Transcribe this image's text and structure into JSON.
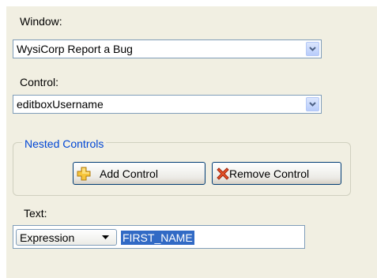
{
  "window_label": "Window:",
  "window_value": "WysiCorp  Report a Bug",
  "control_label": "Control:",
  "control_value": "editboxUsername",
  "nested": {
    "title": "Nested Controls",
    "add_button": "Add Control",
    "remove_button": "Remove Control"
  },
  "text_label": "Text:",
  "text_mode": "Expression",
  "text_value": "FIRST_NAME",
  "icons": {
    "dropdown": "chevron-down-icon",
    "add": "add-plus-icon",
    "remove": "remove-x-icon"
  },
  "colors": {
    "panel": "#f1efe2",
    "group_title": "#0046d5",
    "selection": "#316ac5"
  }
}
